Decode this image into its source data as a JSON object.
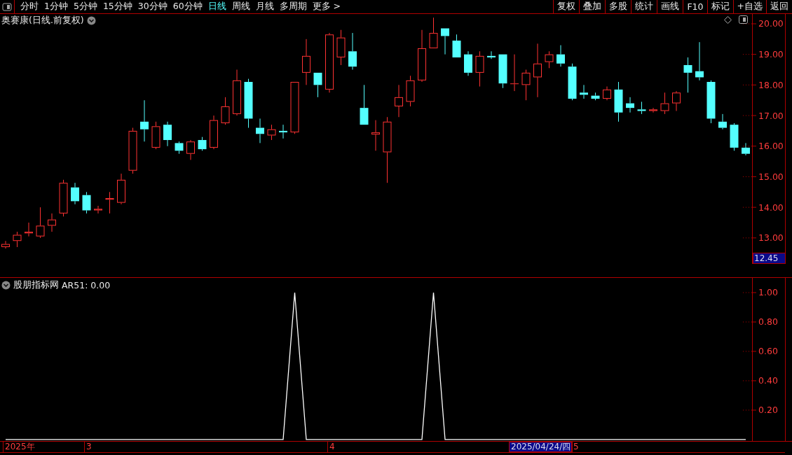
{
  "toolbar": {
    "periods": [
      {
        "label": "分时",
        "selected": false
      },
      {
        "label": "1分钟",
        "selected": false
      },
      {
        "label": "5分钟",
        "selected": false
      },
      {
        "label": "15分钟",
        "selected": false
      },
      {
        "label": "30分钟",
        "selected": false
      },
      {
        "label": "60分钟",
        "selected": false
      },
      {
        "label": "日线",
        "selected": true
      },
      {
        "label": "周线",
        "selected": false
      },
      {
        "label": "月线",
        "selected": false
      },
      {
        "label": "多周期",
        "selected": false
      },
      {
        "label": "更多 >",
        "selected": false
      }
    ],
    "actions": [
      "复权",
      "叠加",
      "多股",
      "统计",
      "画线",
      "F10",
      "标记",
      "+自选",
      "返回"
    ]
  },
  "price_pane": {
    "title": "奥赛康(日线.前复权)",
    "chart_data": {
      "type": "candlestick",
      "ylim": [
        12.15,
        20.32
      ],
      "categories": [
        null,
        null,
        null,
        null,
        null,
        null,
        null,
        null,
        null,
        null,
        null,
        null,
        null,
        null,
        null,
        null,
        null,
        null,
        null,
        null,
        null,
        null,
        null,
        null,
        null,
        null,
        null,
        null,
        null,
        null,
        null,
        null,
        null,
        null,
        null,
        null,
        null,
        null,
        null,
        null,
        null,
        null,
        null,
        null,
        null,
        null,
        null,
        null,
        null,
        null,
        null,
        null,
        null,
        null,
        null,
        null,
        null,
        null,
        null,
        null,
        null,
        null,
        null,
        null,
        null
      ],
      "yticks": [
        {
          "value": 20,
          "label": "20.00"
        },
        {
          "value": 19,
          "label": "19.00"
        },
        {
          "value": 18,
          "label": "18.00"
        },
        {
          "value": 17,
          "label": "17.00"
        },
        {
          "value": 16,
          "label": "16.00"
        },
        {
          "value": 15,
          "label": "15.00"
        },
        {
          "value": 14,
          "label": "14.00"
        },
        {
          "value": 13,
          "label": "13.00"
        }
      ],
      "ohlc": [
        [
          12.7,
          12.9,
          12.65,
          12.8
        ],
        [
          12.9,
          13.2,
          12.7,
          13.1
        ],
        [
          13.15,
          13.5,
          13.05,
          13.2
        ],
        [
          13.05,
          14.0,
          13.0,
          13.4
        ],
        [
          13.4,
          13.8,
          13.2,
          13.6
        ],
        [
          13.8,
          14.9,
          13.7,
          14.8
        ],
        [
          14.65,
          14.8,
          14.1,
          14.2
        ],
        [
          14.4,
          14.5,
          13.8,
          13.9
        ],
        [
          13.9,
          14.05,
          13.8,
          13.95
        ],
        [
          14.25,
          14.5,
          13.8,
          14.3
        ],
        [
          14.15,
          15.1,
          14.1,
          14.9
        ],
        [
          15.2,
          16.6,
          15.1,
          16.5
        ],
        [
          16.8,
          17.5,
          16.15,
          16.55
        ],
        [
          15.95,
          16.8,
          15.9,
          16.65
        ],
        [
          16.7,
          16.8,
          16.0,
          16.2
        ],
        [
          16.1,
          16.15,
          15.75,
          15.85
        ],
        [
          15.75,
          16.2,
          15.55,
          16.15
        ],
        [
          16.2,
          16.3,
          15.85,
          15.9
        ],
        [
          15.95,
          17.0,
          15.9,
          16.85
        ],
        [
          16.75,
          17.6,
          16.7,
          17.3
        ],
        [
          17.05,
          18.5,
          17.0,
          18.15
        ],
        [
          18.1,
          18.2,
          16.6,
          16.9
        ],
        [
          16.6,
          16.9,
          16.1,
          16.4
        ],
        [
          16.35,
          16.7,
          16.2,
          16.55
        ],
        [
          16.5,
          16.7,
          16.25,
          16.45
        ],
        [
          16.45,
          18.1,
          16.4,
          18.1
        ],
        [
          18.4,
          19.5,
          18.0,
          18.95
        ],
        [
          18.4,
          18.4,
          17.6,
          18.0
        ],
        [
          17.85,
          19.7,
          17.75,
          19.65
        ],
        [
          18.9,
          19.8,
          18.65,
          19.55
        ],
        [
          19.1,
          19.7,
          18.5,
          18.6
        ],
        [
          17.25,
          18.0,
          16.7,
          16.7
        ],
        [
          16.38,
          16.85,
          15.85,
          16.45
        ],
        [
          15.8,
          16.95,
          14.8,
          16.8
        ],
        [
          17.3,
          18.0,
          16.95,
          17.6
        ],
        [
          17.45,
          18.3,
          17.3,
          18.15
        ],
        [
          18.15,
          19.8,
          18.1,
          19.2
        ],
        [
          19.2,
          20.2,
          19.2,
          19.7
        ],
        [
          19.85,
          19.85,
          19.0,
          19.6
        ],
        [
          19.45,
          19.65,
          18.9,
          18.9
        ],
        [
          19.0,
          19.1,
          18.3,
          18.4
        ],
        [
          18.4,
          19.1,
          17.95,
          18.95
        ],
        [
          18.95,
          19.1,
          18.85,
          18.9
        ],
        [
          19.0,
          19.0,
          17.9,
          18.05
        ],
        [
          18.04,
          19.0,
          17.8,
          18.05
        ],
        [
          18.0,
          18.5,
          17.5,
          18.4
        ],
        [
          18.25,
          19.35,
          17.6,
          18.7
        ],
        [
          18.75,
          19.1,
          18.55,
          19.0
        ],
        [
          19.0,
          19.3,
          18.6,
          18.7
        ],
        [
          18.6,
          18.7,
          17.5,
          17.55
        ],
        [
          17.75,
          18.0,
          17.55,
          17.68
        ],
        [
          17.65,
          17.75,
          17.5,
          17.55
        ],
        [
          17.55,
          17.95,
          17.5,
          17.85
        ],
        [
          17.85,
          18.1,
          16.8,
          17.1
        ],
        [
          17.4,
          17.6,
          17.1,
          17.25
        ],
        [
          17.2,
          17.45,
          17.05,
          17.15
        ],
        [
          17.15,
          17.25,
          17.1,
          17.2
        ],
        [
          17.15,
          17.75,
          17.05,
          17.4
        ],
        [
          17.4,
          17.8,
          17.15,
          17.75
        ],
        [
          18.65,
          18.9,
          17.75,
          18.4
        ],
        [
          18.45,
          19.4,
          18.15,
          18.25
        ],
        [
          18.1,
          18.15,
          16.75,
          16.9
        ],
        [
          16.8,
          17.05,
          16.55,
          16.6
        ],
        [
          16.7,
          16.75,
          15.85,
          15.95
        ],
        [
          15.95,
          16.1,
          15.7,
          15.75
        ]
      ]
    },
    "last_price": "12.45"
  },
  "indicator_pane": {
    "name": "股朋指标网",
    "reading": "AR51: 0.00",
    "chart_data": {
      "type": "line",
      "ylim": [
        -0.01,
        1.1
      ],
      "yticks": [
        {
          "value": 1,
          "label": "1.00"
        },
        {
          "value": 0.8,
          "label": "0.80"
        },
        {
          "value": 0.6,
          "label": "0.60"
        },
        {
          "value": 0.4,
          "label": "0.40"
        },
        {
          "value": 0.2,
          "label": "0.20"
        }
      ],
      "categories": [
        null,
        null,
        null,
        null,
        null,
        null,
        null,
        null,
        null,
        null,
        null,
        null,
        null,
        null,
        null,
        null,
        null,
        null,
        null,
        null,
        null,
        null,
        null,
        null,
        null,
        null,
        null,
        null,
        null,
        null,
        null,
        null,
        null,
        null,
        null,
        null,
        null,
        null,
        null,
        null,
        null,
        null,
        null,
        null,
        null,
        null,
        null,
        null,
        null,
        null,
        null,
        null,
        null,
        null,
        null,
        null,
        null,
        null,
        null,
        null,
        null,
        null,
        null,
        null,
        null
      ],
      "series": [
        {
          "color": "#ffffff",
          "values": [
            0,
            0,
            0,
            0,
            0,
            0,
            0,
            0,
            0,
            0,
            0,
            0,
            0,
            0,
            0,
            0,
            0,
            0,
            0,
            0,
            0,
            0,
            0,
            0,
            0,
            1,
            0,
            0,
            0,
            0,
            0,
            0,
            0,
            0,
            0,
            0,
            0,
            1,
            0,
            0,
            0,
            0,
            0,
            0,
            0,
            0,
            0,
            0,
            0,
            0,
            0,
            0,
            0,
            0,
            0,
            0,
            0,
            0,
            0,
            0,
            0,
            0,
            0,
            0,
            0
          ]
        }
      ]
    }
  },
  "date_axis": [
    {
      "label": "2025年",
      "selected": false
    },
    {
      "label": "3",
      "selected": false
    },
    {
      "label": "4",
      "selected": false
    },
    {
      "label": "2025/04/24/四",
      "selected": true
    },
    {
      "label": "5",
      "selected": false
    }
  ]
}
